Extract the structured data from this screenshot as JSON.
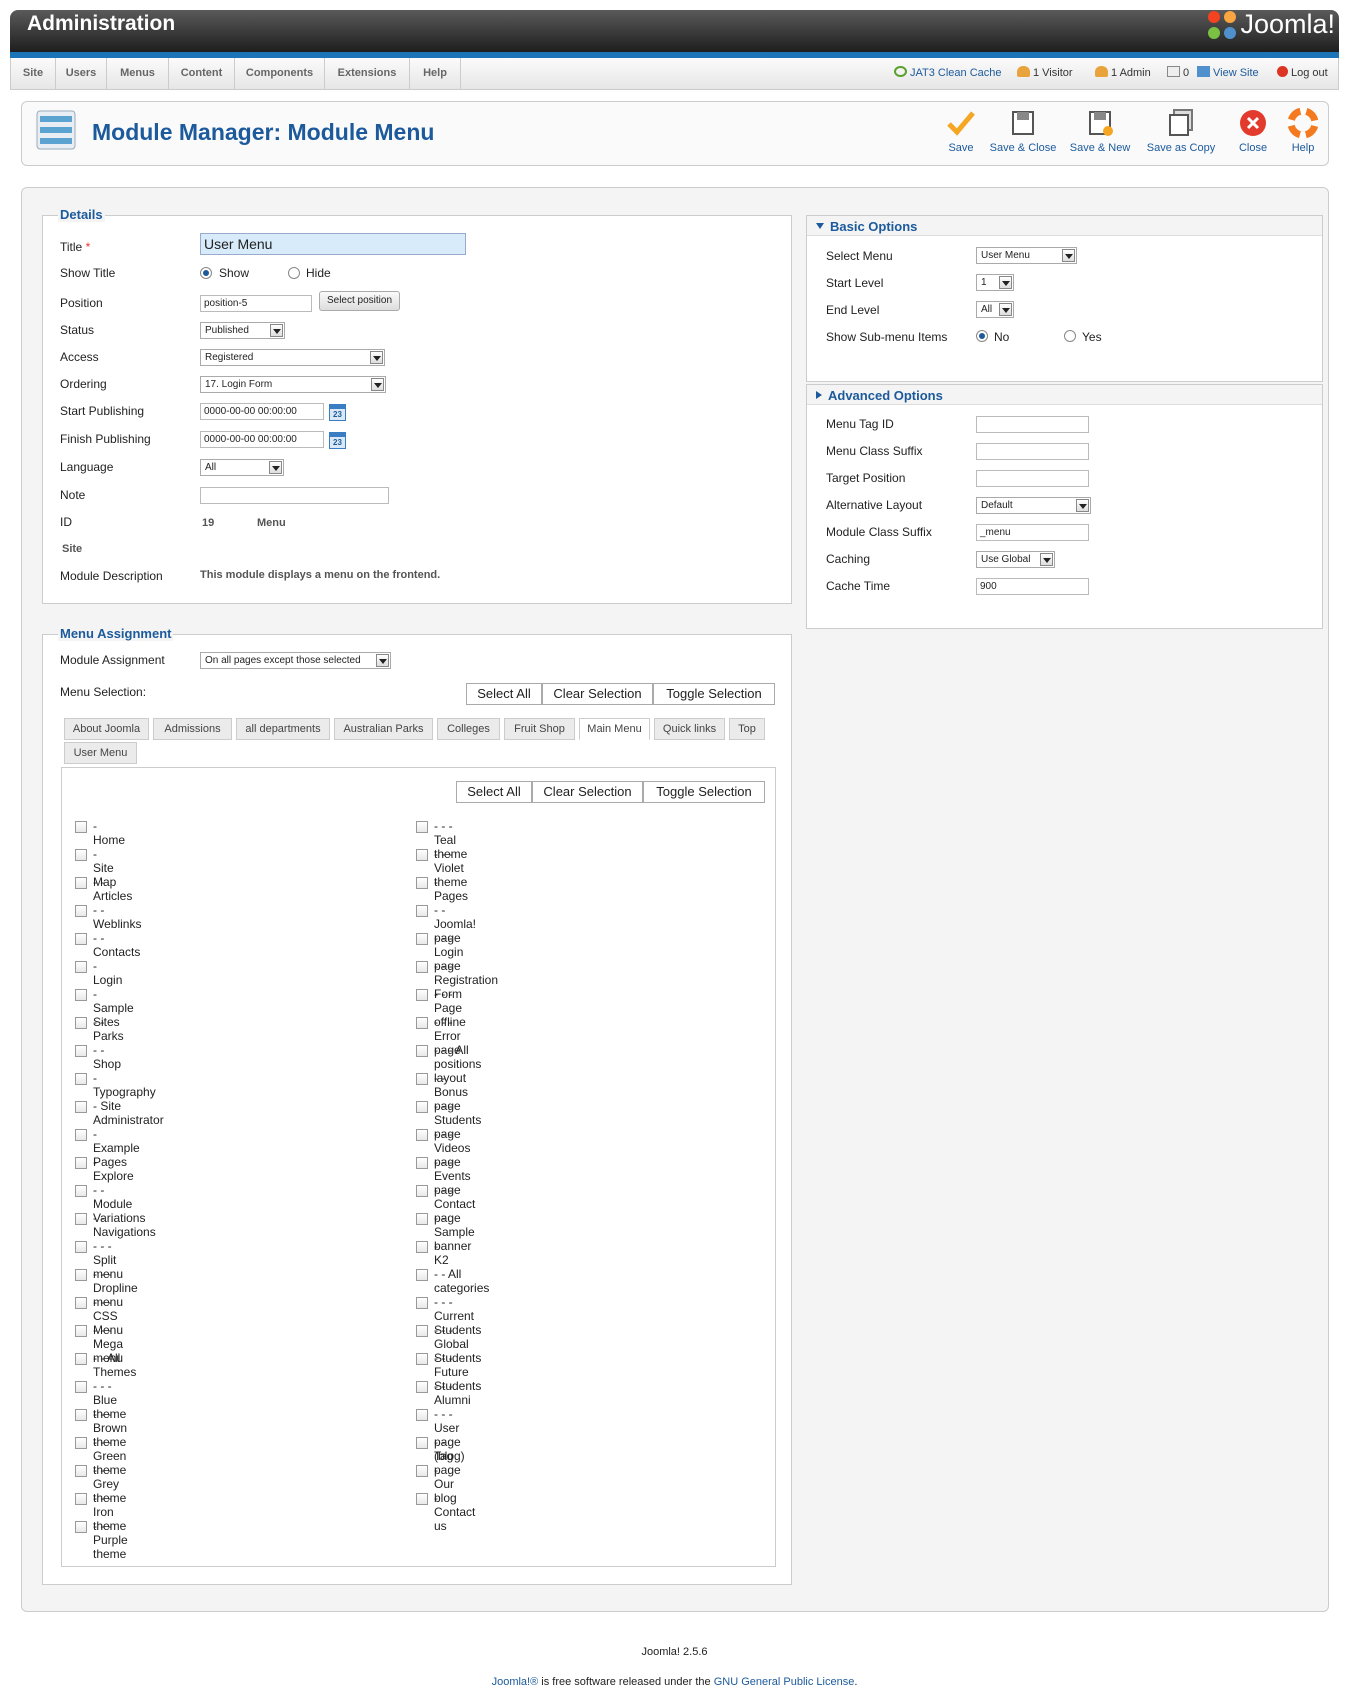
{
  "header": {
    "title": "Administration",
    "logo_text": "Joomla!"
  },
  "menu": [
    "Site",
    "Users",
    "Menus",
    "Content",
    "Components",
    "Extensions",
    "Help"
  ],
  "status": {
    "cache": "JAT3 Clean Cache",
    "visitors": "1 Visitor",
    "admins": "1 Admin",
    "messages": "0",
    "view_site": "View Site",
    "logout": "Log out"
  },
  "page": {
    "title": "Module Manager: Module Menu"
  },
  "toolbar": {
    "save": "Save",
    "save_close": "Save & Close",
    "save_new": "Save & New",
    "save_copy": "Save as Copy",
    "close": "Close",
    "help": "Help"
  },
  "details": {
    "legend": "Details",
    "title_label": "Title",
    "required_mark": "*",
    "title_value": "User Menu",
    "show_title_label": "Show Title",
    "show": "Show",
    "hide": "Hide",
    "position_label": "Position",
    "position_value": "position-5",
    "select_position": "Select position",
    "status_label": "Status",
    "status_value": "Published",
    "access_label": "Access",
    "access_value": "Registered",
    "ordering_label": "Ordering",
    "ordering_value": "17. Login Form",
    "start_label": "Start Publishing",
    "start_value": "0000-00-00 00:00:00",
    "finish_label": "Finish Publishing",
    "finish_value": "0000-00-00 00:00:00",
    "calendar_day": "23",
    "language_label": "Language",
    "language_value": "All",
    "note_label": "Note",
    "note_value": "",
    "id_label": "ID",
    "id_value": "19",
    "type_value": "Menu",
    "client_value": "Site",
    "desc_label": "Module Description",
    "desc_value": "This module displays a menu on the frontend."
  },
  "assignment": {
    "legend": "Menu Assignment",
    "module_assignment_label": "Module Assignment",
    "module_assignment_value": "On all pages except those selected",
    "menu_selection_label": "Menu Selection:",
    "select_all": "Select All",
    "clear_selection": "Clear Selection",
    "toggle_selection": "Toggle Selection",
    "tabs": [
      "About Joomla",
      "Admissions",
      "all departments",
      "Australian Parks",
      "Colleges",
      "Fruit Shop",
      "Main Menu",
      "Quick links",
      "Top",
      "User Menu"
    ],
    "col1": [
      "- Home",
      "- Site Map",
      "- - Articles",
      "- - Weblinks",
      "- - Contacts",
      "- Login",
      "- Sample Sites",
      "- - Parks",
      "- - Shop",
      "- Typography",
      "- Site Administrator",
      "- Example Pages",
      "- Explore",
      "- - Module Variations",
      "- - Navigations",
      "- - - Split menu",
      "- - - Dropline menu",
      "- - - CSS Menu",
      "- - - Mega menu",
      "- - All Themes",
      "- - - Blue theme",
      "- - - Brown theme",
      "- - - Green theme",
      "- - - Grey theme",
      "- - - Iron theme",
      "- - - Purple theme"
    ],
    "col2": [
      "- - - Teal theme",
      "- - - Violet theme",
      "- Pages",
      "- - Joomla! page",
      "- - - Login page",
      "- - - Registration Form",
      "- - - Page offline",
      "- - - Error page",
      "- - - All positions layout",
      "- - Bonus page",
      "- - - Students page",
      "- - - Videos page",
      "- - - Events page",
      "- - - Contact page",
      "- - Sample banner",
      "- K2",
      "- - All categories",
      "- - - Current Students",
      "- - - Global Students",
      "- - - Future Students",
      "- - - Alumni",
      "- - - User page (blog)",
      "- - Tag page",
      "- Our blog",
      "- Contact us"
    ]
  },
  "basic": {
    "title": "Basic Options",
    "select_menu_label": "Select Menu",
    "select_menu_value": "User Menu",
    "start_level_label": "Start Level",
    "start_level_value": "1",
    "end_level_label": "End Level",
    "end_level_value": "All",
    "submenu_label": "Show Sub-menu Items",
    "no": "No",
    "yes": "Yes"
  },
  "advanced": {
    "title": "Advanced Options",
    "tag_id_label": "Menu Tag ID",
    "tag_id_value": "",
    "class_suffix_label": "Menu Class Suffix",
    "class_suffix_value": "",
    "target_label": "Target Position",
    "target_value": "",
    "layout_label": "Alternative Layout",
    "layout_value": "Default",
    "module_class_label": "Module Class Suffix",
    "module_class_value": "_menu",
    "caching_label": "Caching",
    "caching_value": "Use Global",
    "cache_time_label": "Cache Time",
    "cache_time_value": "900"
  },
  "footer": {
    "version": "Joomla! 2.5.6",
    "brand": "Joomla!®",
    "text": " is free software released under the ",
    "license": "GNU General Public License",
    "dot": "."
  },
  "colors": {
    "accent": "#1c5a9c",
    "topbar_border": "#1c74b8"
  }
}
